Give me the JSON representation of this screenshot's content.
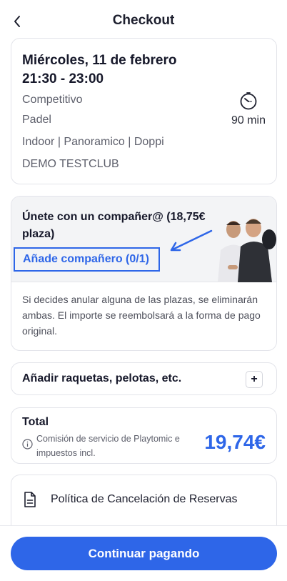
{
  "header": {
    "title": "Checkout",
    "back_icon": "chevron-left-icon"
  },
  "booking": {
    "date": "Miércoles, 11 de febrero",
    "time": "21:30 - 23:00",
    "level": "Competitivo",
    "sport": "Padel",
    "court_features": "Indoor | Panoramico  | Doppi",
    "club": "DEMO TESTCLUB",
    "duration": "90 min",
    "duration_icon": "stopwatch-icon"
  },
  "partner": {
    "title": "Únete con un compañer@ (18,75€ plaza)",
    "add_label": "Añade compañero (0/1)",
    "note": "Si decides anular alguna de las plazas, se eliminarán ambas. El importe se reembolsará a la forma de pago original.",
    "highlight_color": "#2e66e8"
  },
  "extras": {
    "label": "Añadir raquetas, pelotas, etc.",
    "plus": "+"
  },
  "total": {
    "label": "Total",
    "fee_note": "Comisión de servicio de Playtomic e impuestos incl.",
    "amount": "19,74€"
  },
  "policy": {
    "label": "Política de Cancelación de Reservas",
    "icon": "document-icon"
  },
  "cta": {
    "label": "Continuar pagando",
    "color": "#2e66e8"
  }
}
